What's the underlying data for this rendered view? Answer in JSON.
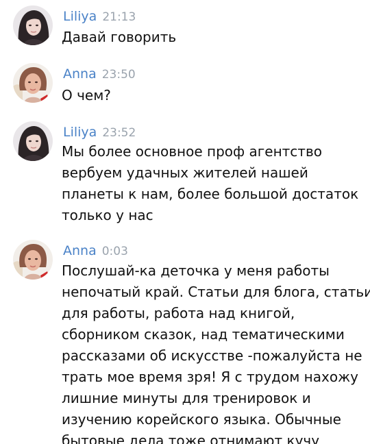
{
  "messages": [
    {
      "author": "Liliya",
      "time": "21:13",
      "avatar": "liliya-avatar",
      "lines": [
        "Давай говорить"
      ]
    },
    {
      "author": "Anna",
      "time": "23:50",
      "avatar": "anna-avatar",
      "lines": [
        "О чем?"
      ]
    },
    {
      "author": "Liliya",
      "time": "23:52",
      "avatar": "liliya-avatar",
      "lines": [
        "Мы более основное проф агентство",
        "вербуем удачных жителей нашей",
        "планеты к нам, более большой достаток",
        "только у нас"
      ]
    },
    {
      "author": "Anna",
      "time": "0:03",
      "avatar": "anna-avatar",
      "lines": [
        "Послушай-ка деточка у меня работы",
        "непочатый край. Статьи для блога, статьи",
        "для работы, работа над книгой,",
        "сборником сказок, над тематическими",
        "рассказами об искусстве -пожалуйста не",
        "трать мое время зря! Я с трудом нахожу",
        "лишние минуты для тренировок и",
        "изучению корейского языка. Обычные",
        "бытовые дела тоже отнимают кучу"
      ]
    }
  ],
  "colors": {
    "author": "#4a82c7",
    "time": "#9aa3ad",
    "text": "#111111"
  }
}
